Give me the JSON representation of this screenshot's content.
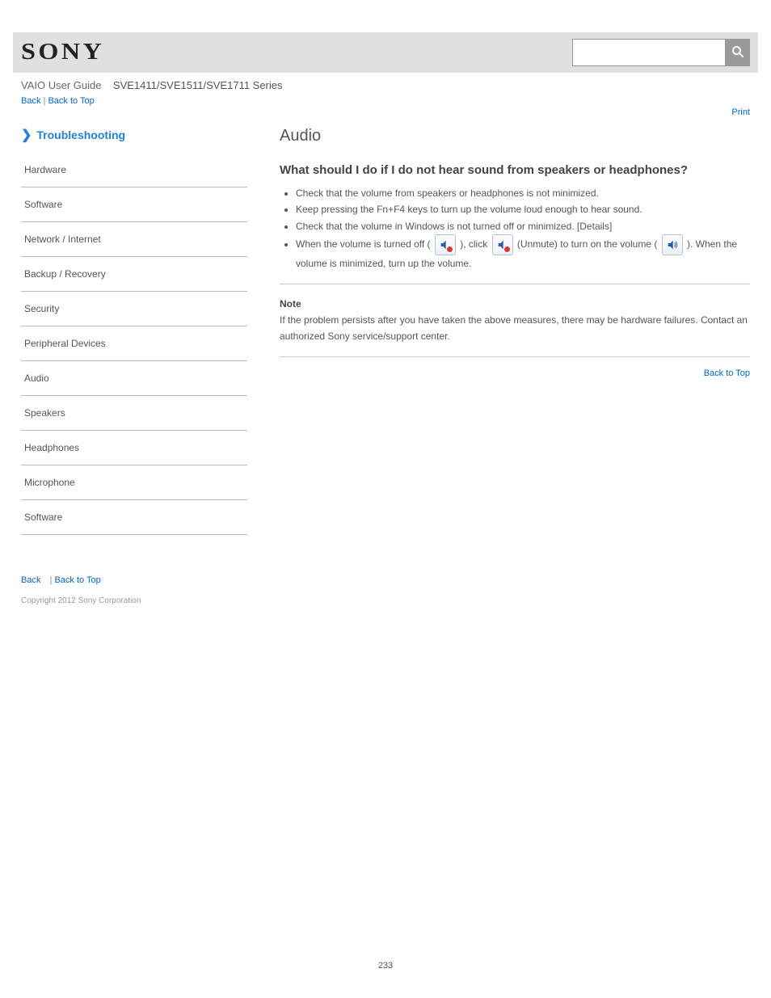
{
  "header": {
    "logo_text": "SONY",
    "product_line": "VAIO User Guide",
    "series": "SVE1411/SVE1511/SVE1711 Series"
  },
  "breadcrumb": {
    "back": "Back",
    "sep1": " | ",
    "back_top": "Back to Top"
  },
  "toplink": "Print",
  "sidebar": {
    "title": "Troubleshooting",
    "items": [
      "Hardware",
      "Software",
      "Network / Internet",
      "Backup / Recovery",
      "Security",
      "Peripheral Devices",
      "Audio",
      "Speakers",
      "Headphones",
      "Microphone",
      "Software"
    ]
  },
  "main": {
    "title": "Audio",
    "q1": {
      "heading": "What should I do if I do not hear sound from speakers or headphones?",
      "bullets": [
        "Check that the volume from speakers or headphones is not minimized.",
        "Keep pressing the Fn+F4 keys to turn up the volume loud enough to hear sound.",
        "Check that the volume in Windows is not turned off or minimized. [Details]",
        "When the volume is turned off ( ), click  (Unmute) to turn on the volume ( ). When the volume is minimized, turn up the volume."
      ],
      "inline_text_1": "When the volume is turned off (",
      "inline_text_2": "), click ",
      "inline_text_3": " (Unmute) to turn on the volume (",
      "inline_text_4": "). When the volume is minimized, turn up the volume."
    },
    "note": {
      "label": "Note",
      "text": "If the problem persists after you have taken the above measures, there may be hardware failures. Contact an authorized Sony service/support center."
    },
    "backtop": "Back to Top"
  },
  "footer": {
    "links": [
      "Back",
      "Back to Top"
    ],
    "copyright": "Copyright 2012 Sony Corporation"
  },
  "pagenum": "233"
}
